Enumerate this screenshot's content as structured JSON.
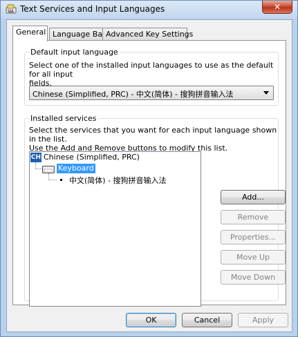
{
  "window": {
    "title": "Text Services and Input Languages",
    "close_label": "✕"
  },
  "tabs": [
    {
      "label": "General",
      "active": true
    },
    {
      "label": "Language Bar",
      "active": false
    },
    {
      "label": "Advanced Key Settings",
      "active": false
    }
  ],
  "default_input": {
    "group_label": "Default input language",
    "description_line1": "Select one of the installed input languages to use as the default for all input",
    "description_line2": "fields.",
    "selected_value": "Chinese (Simplified, PRC) - 中文(简体) - 搜狗拼音输入法"
  },
  "installed_services": {
    "group_label": "Installed services",
    "description_line1": "Select the services that you want for each input language shown in the list.",
    "description_line2": "Use the Add and Remove buttons to modify this list.",
    "tree": {
      "language_badge": "CH",
      "language_label": "Chinese (Simplified, PRC)",
      "category_label": "Keyboard",
      "service_label": "中文(简体) - 搜狗拼音输入法"
    },
    "buttons": {
      "add": "Add...",
      "remove": "Remove",
      "properties": "Properties...",
      "move_up": "Move Up",
      "move_down": "Move Down"
    }
  },
  "footer": {
    "ok": "OK",
    "cancel": "Cancel",
    "apply": "Apply"
  }
}
